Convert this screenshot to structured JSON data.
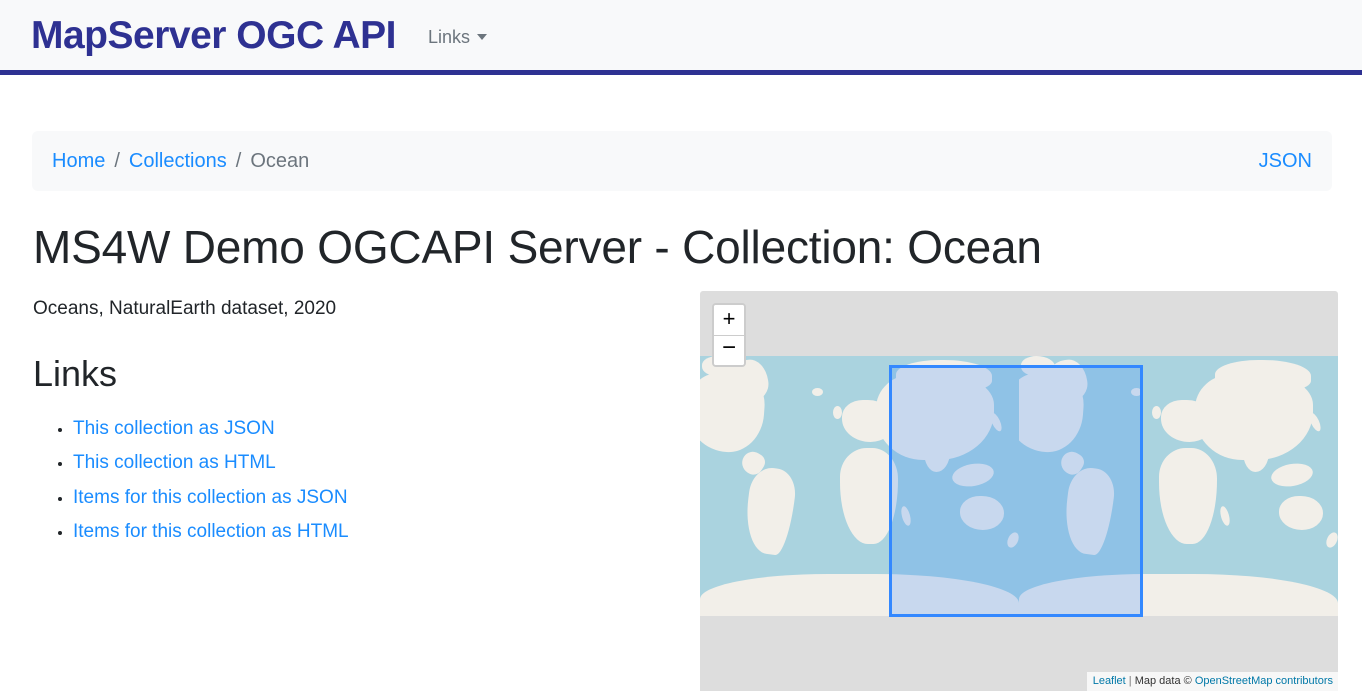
{
  "navbar": {
    "brand": "MapServer OGC API",
    "dropdown_label": "Links",
    "brand_color": "#2e3192",
    "background": "#f8f9fa",
    "border_color": "#2e3192"
  },
  "breadcrumb": {
    "items": [
      {
        "label": "Home",
        "active": false
      },
      {
        "label": "Collections",
        "active": false
      },
      {
        "label": "Ocean",
        "active": true
      }
    ],
    "separator": "/",
    "right_link": "JSON",
    "link_color": "#1a8cff",
    "active_color": "#6c757d"
  },
  "main": {
    "title": "MS4W Demo OGCAPI Server - Collection: Ocean",
    "description": "Oceans, NaturalEarth dataset, 2020",
    "links_heading": "Links",
    "links": [
      {
        "label": "This collection as JSON"
      },
      {
        "label": "This collection as HTML"
      },
      {
        "label": "Items for this collection as JSON"
      },
      {
        "label": "Items for this collection as HTML"
      }
    ]
  },
  "map": {
    "zoom_in_label": "+",
    "zoom_out_label": "−",
    "attribution": {
      "leaflet": "Leaflet",
      "separator": "|",
      "prefix": "Map data ©",
      "osm": "OpenStreetMap contributors"
    },
    "bbox_border_color": "#3388ff",
    "water_color": "#aad3df",
    "land_color": "#f2efe9",
    "background_color": "#dddddd"
  }
}
